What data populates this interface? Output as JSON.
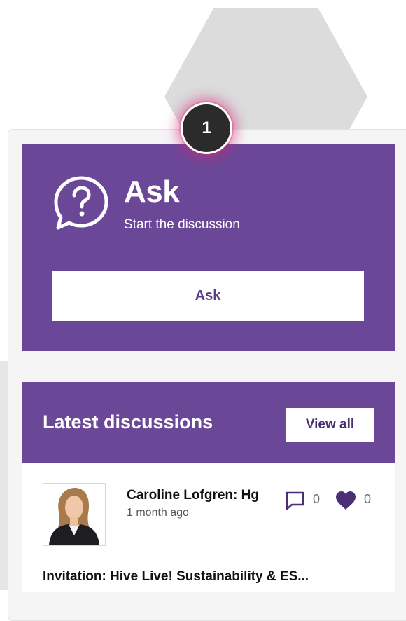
{
  "step_badge": {
    "number": "1"
  },
  "ask_card": {
    "icon": "question-bubble-icon",
    "title": "Ask",
    "subtitle": "Start the discussion",
    "button_label": "Ask"
  },
  "latest_discussions": {
    "title": "Latest discussions",
    "view_all_label": "View all",
    "items": [
      {
        "author": "Caroline Lofgren: Hg",
        "time": "1 month ago",
        "comments": "0",
        "likes": "0",
        "title": "Invitation: Hive Live! Sustainability & ES..."
      }
    ]
  },
  "colors": {
    "brand_purple": "#6a4797",
    "badge_dark": "#2b2b2b",
    "badge_glow": "#d62878"
  }
}
